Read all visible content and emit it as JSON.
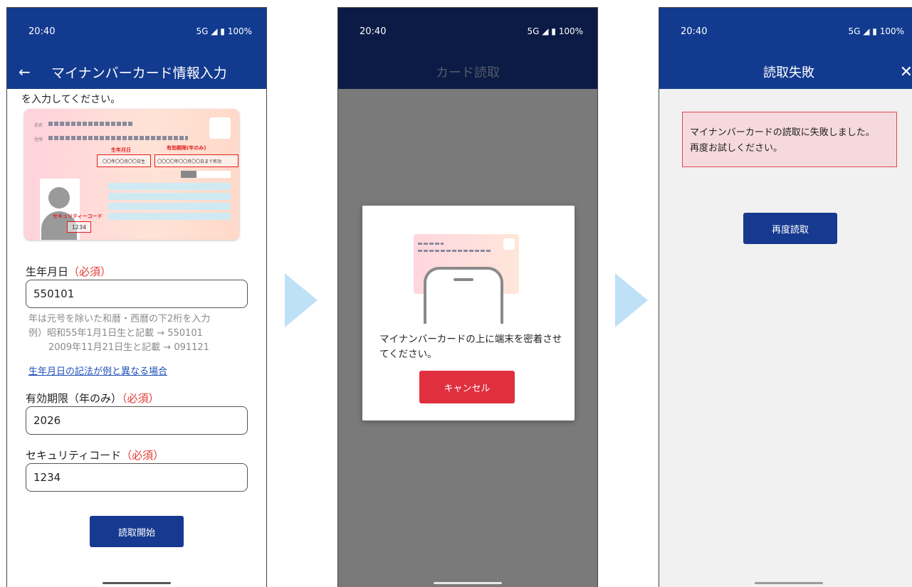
{
  "screen1": {
    "time": "20:40",
    "signal": "5G ◢ ▮ 100%",
    "title": "マイナンバーカード情報入力",
    "instruction": "を入力してください。",
    "card": {
      "name_label": "氏名",
      "address_label": "住所",
      "birthdate_label": "生年月日",
      "birthdate_value": "〇〇年〇〇月〇〇日生",
      "expiry_label": "有効期限(年のみ)",
      "expiry_value": "〇〇〇〇年〇〇月〇〇日まで有効",
      "security_label": "セキュリティーコード",
      "security_value": "1234"
    },
    "birthdate": {
      "label": "生年月日",
      "required": "（必須）",
      "value": "550101",
      "hint1": "年は元号を除いた和暦・西暦の下2桁を入力",
      "hint2": "例）昭和55年1月1日生と記載 → 550101",
      "hint3": "2009年11月21日生と記載 → 091121",
      "link": "生年月日の記法が例と異なる場合"
    },
    "expiry": {
      "label": "有効期限（年のみ）",
      "required": "（必須）",
      "value": "2026"
    },
    "security": {
      "label": "セキュリティコード",
      "required": "（必須）",
      "value": "1234"
    },
    "button": "読取開始"
  },
  "screen2": {
    "time": "20:40",
    "signal": "5G ◢ ▮ 100%",
    "title": "カード読取",
    "modal_text": "マイナンバーカードの上に端末を密着させてください。",
    "cancel": "キャンセル"
  },
  "screen3": {
    "time": "20:40",
    "signal": "5G ◢ ▮ 100%",
    "title": "読取失敗",
    "close": "✕",
    "error_line1": "マイナンバーカードの読取に失敗しました。",
    "error_line2": "再度お試しください。",
    "retry": "再度読取"
  },
  "colors": {
    "primary": "#123a8f",
    "navy": "#0b1b45",
    "required": "#e53935",
    "cancel": "#e0303f",
    "arrow": "#bfe1f7"
  },
  "icons": {
    "back": "arrow-left-icon",
    "close": "close-icon",
    "step_arrow": "triangle-right-icon"
  }
}
